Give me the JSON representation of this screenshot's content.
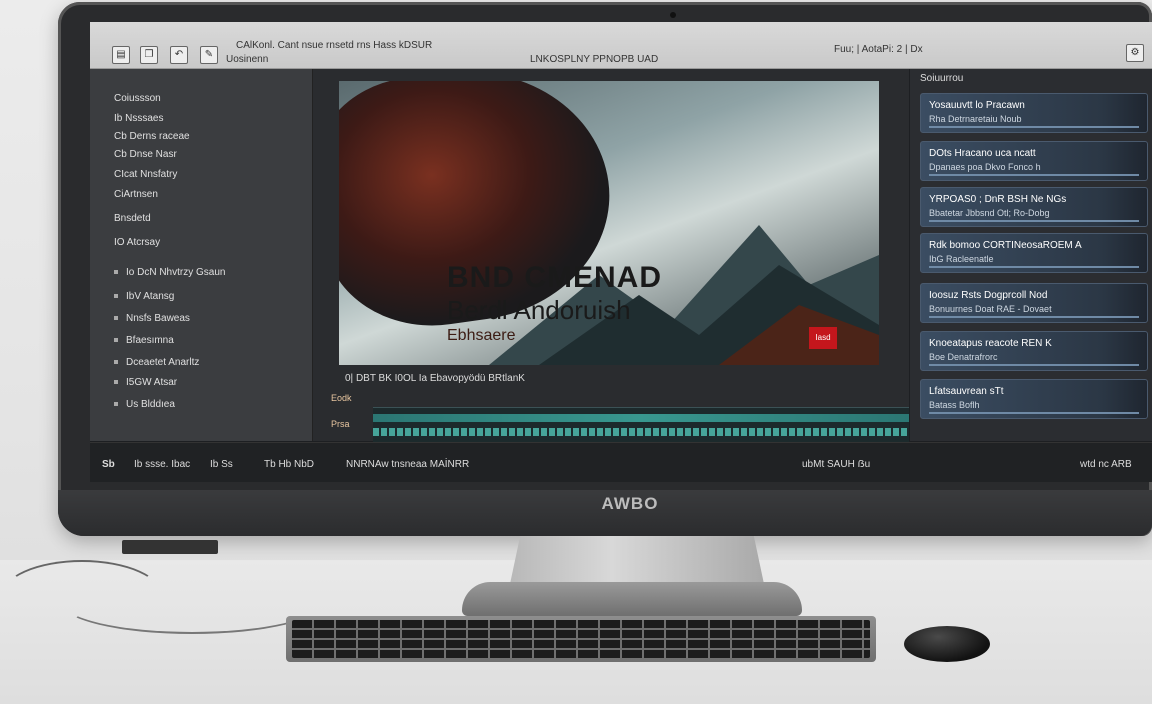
{
  "device": {
    "brand": "AWBO"
  },
  "topbar": {
    "icons": [
      "file-icon",
      "copy-icon",
      "undo-icon",
      "brush-icon"
    ],
    "menu_left": "CAlKonl. Cant nsue rnsetd rns Hass kDSUR",
    "menu_mid": "Uosinenn",
    "menu_right": "LNKOSPLNY PPNOPB UAD",
    "menu_far": "Fuu; | AotaPi: 2 | Dx"
  },
  "sidebar": {
    "items": [
      "Coiussson",
      "Ib Nsssaes",
      "Cb Derns raceae",
      "Cb Dnse Nasr",
      "CIcat Nnsfatry",
      "CiArtnsen",
      "Bnsdetd",
      "IO Atcrsay",
      "Io DcN Nhvtrzy Gsaun",
      "IbV Atansg",
      "Nnsfs Baweas",
      "Bfaesımna",
      "Dceaetet Anarltz",
      "I5GW Atsar",
      "Us Blddıea"
    ]
  },
  "preview": {
    "title_line1": "BND CMENAD",
    "title_line2": "Berdl Andoruish",
    "title_line3": "Ebhsaere",
    "badge": "Iasd",
    "transport": "0|  DBT BK I0OL Ia     Ebavopyödü BRtlanK",
    "timeline_label_1": "Eodk",
    "timeline_label_2": "Prsa"
  },
  "rightpane": {
    "header": "Soiuurrou",
    "cards": [
      {
        "title": "Yosauuvtt lo Pracawn",
        "sub": "Rha Detrnaretaiu Noub"
      },
      {
        "title": "DOts Hracano uca ncatt",
        "sub": "Dpanaes poa Dkvo Fonco h"
      },
      {
        "title": "YRPOAS0 ; DnR BSH Ne NGs",
        "sub": "Bbatetar Jbbsnd Otl; Ro-Dobg"
      },
      {
        "title": "Rdk bomoo  CORTINeosaROEM A",
        "sub": "IbG Racleenatle"
      },
      {
        "title": "Ioosuz Rsts Dogprcoll Nod",
        "sub": "Bonuurnes Doat RAE - Dovaet"
      },
      {
        "title": "Knoeatapus reacote REN K",
        "sub": "Boe Denatrafrorc"
      },
      {
        "title": "Lfatsauvrean sTt",
        "sub": "Batass Boflh"
      }
    ]
  },
  "statusbar": {
    "left_code": "Sb",
    "left_text": "Ib ssse. Ibac",
    "seg2": "Ib Ss",
    "seg3": "Tb Hb NbD",
    "seg4": "NNRNAw tnsneaa MAİNRR",
    "right_text": "ubMt SAUH ẞu",
    "far_right": "wtd nc ARB"
  },
  "colors": {
    "accent_red": "#c4161c",
    "card_blue": "#3b4d62",
    "timeline_teal": "#2f8a85"
  }
}
